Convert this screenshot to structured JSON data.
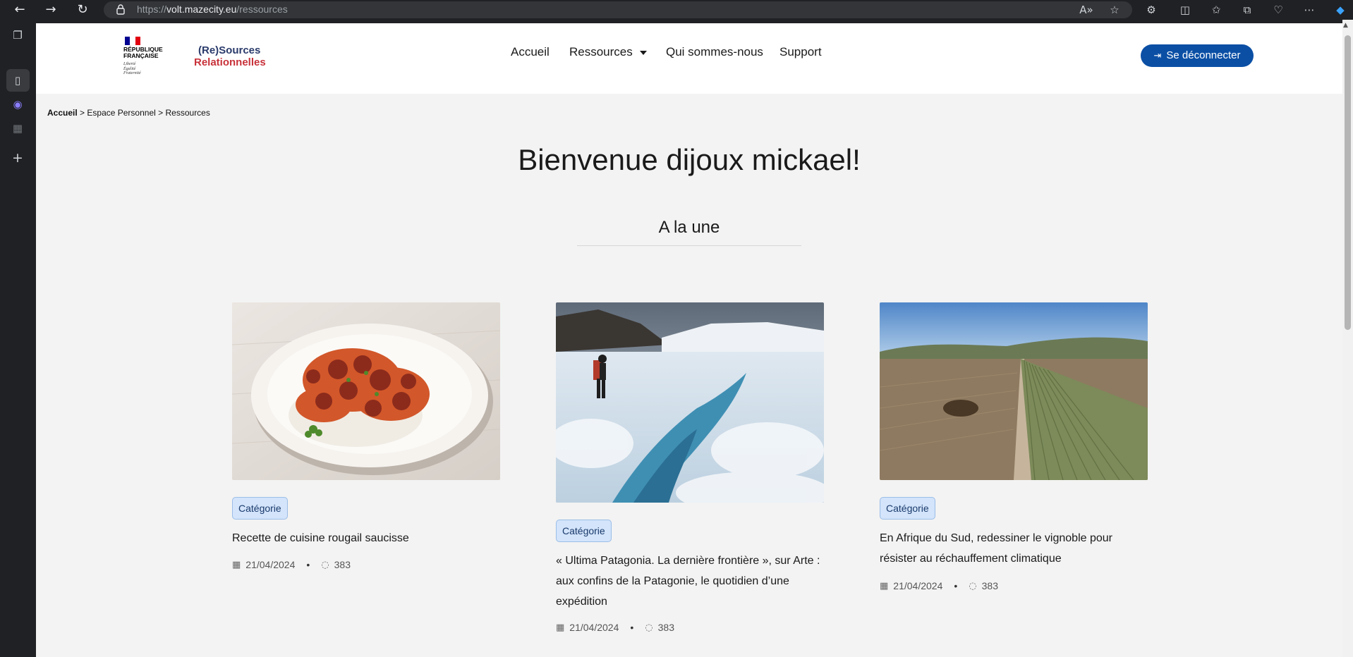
{
  "browser": {
    "url_scheme": "https://",
    "url_host": "volt.mazecity.eu",
    "url_path": "/ressources",
    "back_icon": "back-arrow-icon",
    "forward_icon": "forward-arrow-icon",
    "reload_icon": "reload-icon"
  },
  "header": {
    "rf_line1": "RÉPUBLIQUE",
    "rf_line2": "FRANÇAISE",
    "rf_motto1": "Liberté",
    "rf_motto2": "Égalité",
    "rf_motto3": "Fraternité",
    "brand_line1": "(Re)Sources",
    "brand_line2": "Relationnelles",
    "menu": [
      "Accueil",
      "Ressources",
      "Qui sommes-nous",
      "Support"
    ],
    "logout_label": "Se déconnecter"
  },
  "breadcrumb": {
    "home": "Accueil",
    "sep": ">",
    "item2": "Espace Personnel",
    "item3": "Ressources"
  },
  "welcome": "Bienvenue dijoux mickael!",
  "section_title": "A la une",
  "cards": [
    {
      "category": "Catégorie",
      "title": "Recette de cuisine rougail saucisse",
      "date": "21/04/2024",
      "comments": "383",
      "image": "food-plate-image"
    },
    {
      "category": "Catégorie",
      "title": "« Ultima Patagonia. La dernière frontière », sur Arte : aux confins de la Patagonie, le quotidien d’une expédition",
      "date": "21/04/2024",
      "comments": "383",
      "image": "glacier-hiker-image"
    },
    {
      "category": "Catégorie",
      "title": "En Afrique du Sud, redessiner le vignoble pour résister au réchauffement climatique",
      "date": "21/04/2024",
      "comments": "383",
      "image": "vineyard-aerial-image"
    }
  ],
  "colors": {
    "primary": "#0b4fa5",
    "brand_blue": "#2a3b6b",
    "brand_red": "#c8323a",
    "badge_bg": "#d3e4fb"
  }
}
